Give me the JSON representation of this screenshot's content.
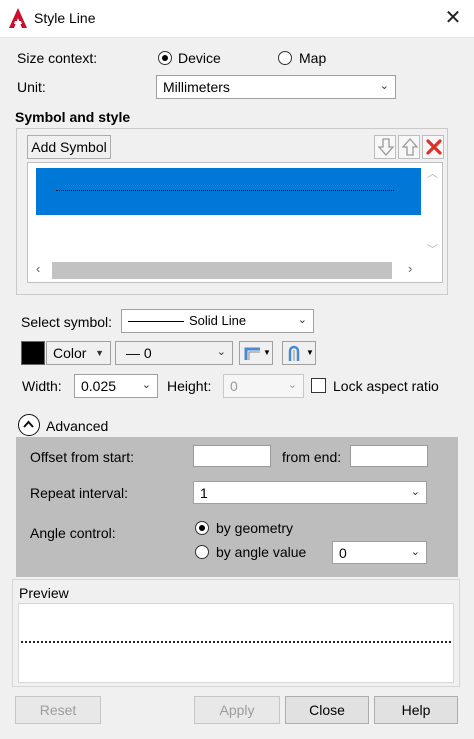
{
  "window": {
    "title": "Style Line",
    "close_glyph": "✕"
  },
  "size_context": {
    "label": "Size context:",
    "options": [
      {
        "label": "Device",
        "selected": true
      },
      {
        "label": "Map",
        "selected": false
      }
    ]
  },
  "unit": {
    "label": "Unit:",
    "value": "Millimeters"
  },
  "symbol_style": {
    "heading": "Symbol and style",
    "add_symbol_label": "Add Symbol"
  },
  "select_symbol": {
    "label": "Select symbol:",
    "value": "Solid Line"
  },
  "color": {
    "label": "Color",
    "swatch": "#000000"
  },
  "lineweight": {
    "value": "— 0"
  },
  "width": {
    "label": "Width:",
    "value": "0.025"
  },
  "height": {
    "label": "Height:",
    "value": "0"
  },
  "lock_aspect": {
    "label": "Lock aspect ratio",
    "checked": false
  },
  "advanced": {
    "label": "Advanced",
    "offset_from_start_label": "Offset from start:",
    "offset_from_start_value": "",
    "from_end_label": "from end:",
    "from_end_value": "",
    "repeat_interval_label": "Repeat interval:",
    "repeat_interval_value": "1",
    "angle_control_label": "Angle control:",
    "angle_options": [
      {
        "label": "by geometry",
        "selected": true
      },
      {
        "label": "by angle value",
        "selected": false
      }
    ],
    "angle_value": "0"
  },
  "preview": {
    "label": "Preview"
  },
  "buttons": {
    "reset": "Reset",
    "apply": "Apply",
    "close": "Close",
    "help": "Help"
  },
  "colors": {
    "selected_row": "#0078d7",
    "delete_red": "#d8322a",
    "advanced_bg": "#bdbdbd"
  }
}
